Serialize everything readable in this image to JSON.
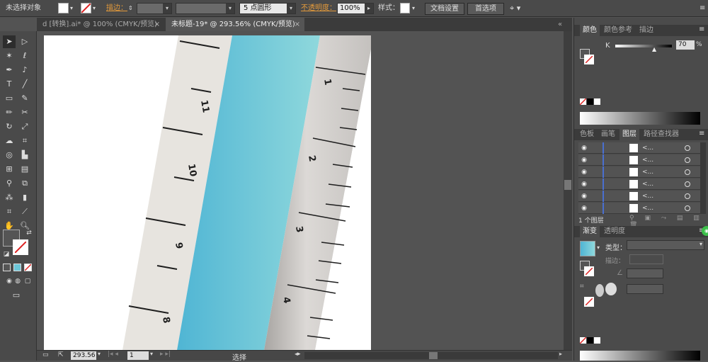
{
  "control_bar": {
    "selection_status": "未选择对象",
    "stroke_label": "描边：",
    "brush_value": "5 点圆形",
    "opacity_label": "不透明度：",
    "opacity_value": "100%",
    "style_label": "样式：",
    "doc_setup_button": "文档设置",
    "preferences_button": "首选项"
  },
  "document_tabs": [
    {
      "label": "d [转换].ai* @ 100% (CMYK/预览)",
      "active": false
    },
    {
      "label": "未标题-19* @ 293.56% (CMYK/预览)",
      "active": true
    }
  ],
  "ruler": {
    "left_numbers": [
      "11",
      "10",
      "9",
      "8"
    ],
    "right_numbers": [
      "1",
      "2",
      "3",
      "4"
    ],
    "colors": {
      "face_top": "#5dbfd8",
      "face_bottom": "#86d5dc",
      "edge": "#e7e4df",
      "side": "#d2cfcc",
      "tick": "#222222"
    }
  },
  "status_bar": {
    "zoom": "293.56",
    "page": "1",
    "tool": "选择"
  },
  "color_panel": {
    "tabs": [
      "颜色",
      "颜色参考",
      "描边"
    ],
    "channel": "K",
    "value": "70",
    "unit": "%"
  },
  "layers_panel": {
    "tabs": [
      "色板",
      "画笔",
      "图层",
      "路径查找器"
    ],
    "rows": [
      "<...",
      "<...",
      "<...",
      "<...",
      "<...",
      "<..."
    ],
    "footer": "1 个图层"
  },
  "gradient_panel": {
    "tabs": [
      "渐变",
      "透明度"
    ],
    "type_label": "类型：",
    "stroke_label": "描边："
  }
}
